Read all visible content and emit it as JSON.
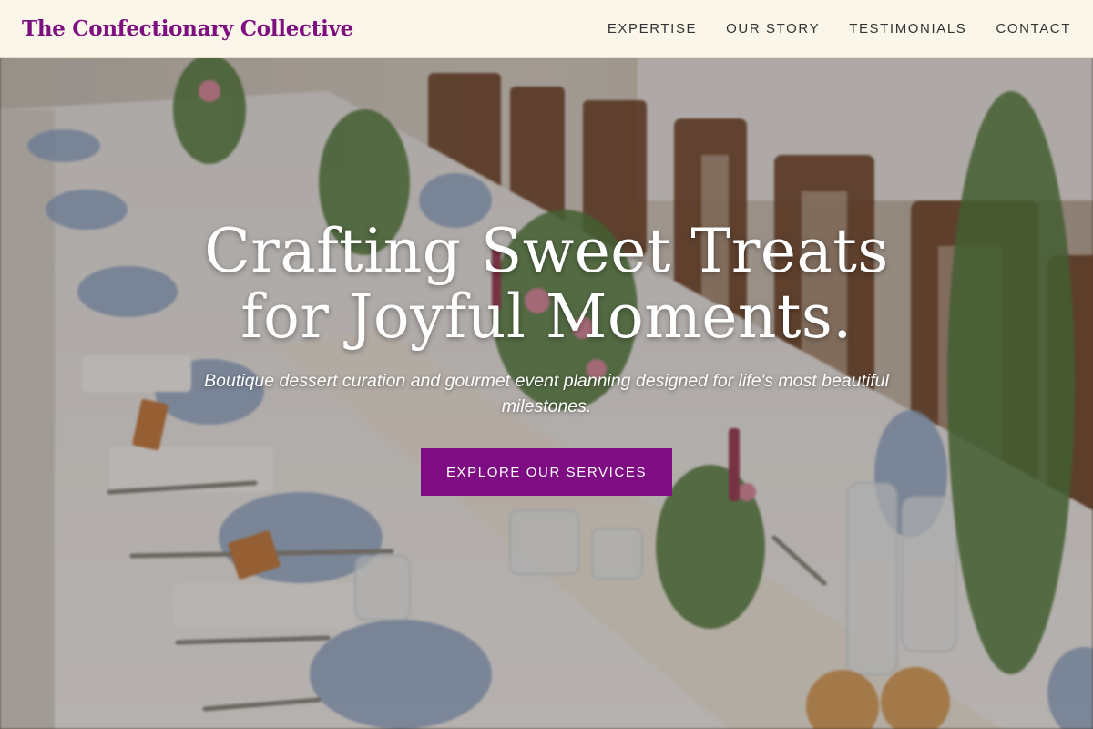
{
  "brand": {
    "name": "The Confectionary Collective",
    "color": "#7e0f7e"
  },
  "nav": {
    "links": [
      {
        "label": "EXPERTISE"
      },
      {
        "label": "OUR STORY"
      },
      {
        "label": "TESTIMONIALS"
      },
      {
        "label": "CONTACT"
      }
    ]
  },
  "hero": {
    "title": "Crafting Sweet Treats for Joyful Moments.",
    "subtitle": "Boutique dessert curation and gourmet event planning designed for life's most beautiful milestones.",
    "cta_label": "EXPLORE OUR SERVICES",
    "background_image": "banquet-table-photo",
    "accent_color": "#7e0c83"
  }
}
